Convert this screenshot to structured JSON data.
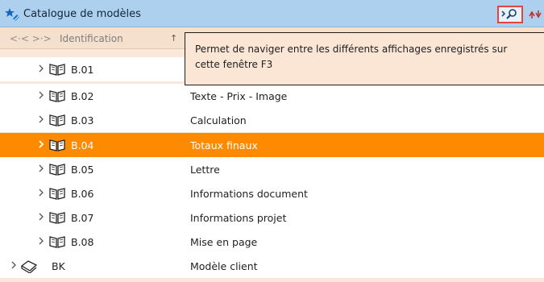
{
  "window": {
    "title": "Catalogue de modèles",
    "nav_button_icon": "view-navigator-icon",
    "refresh_button_icon": "refresh-icon"
  },
  "header": {
    "nav_arrows": "<·< >·>",
    "column_label": "Identification",
    "sort_indicator": "↑"
  },
  "tooltip": {
    "line1": "Permet de naviger entre les différents affichages enregistrés sur",
    "line2": "cette fenêtre  F3"
  },
  "rows": [
    {
      "code": "B.01",
      "label": "",
      "icon": "book-icon",
      "selected": false
    },
    {
      "code": "B.02",
      "label": "Texte - Prix - Image",
      "icon": "book-icon",
      "selected": false
    },
    {
      "code": "B.03",
      "label": "Calculation",
      "icon": "book-icon",
      "selected": false
    },
    {
      "code": "B.04",
      "label": "Totaux finaux",
      "icon": "book-icon",
      "selected": true
    },
    {
      "code": "B.05",
      "label": "Lettre",
      "icon": "book-icon",
      "selected": false
    },
    {
      "code": "B.06",
      "label": "Informations document",
      "icon": "book-icon",
      "selected": false
    },
    {
      "code": "B.07",
      "label": "Informations projet",
      "icon": "book-icon",
      "selected": false
    },
    {
      "code": "B.08",
      "label": "Mise en page",
      "icon": "book-icon",
      "selected": false
    },
    {
      "code": "BK",
      "label": "Modèle client",
      "icon": "catalog-icon",
      "selected": false
    }
  ],
  "colors": {
    "titlebar": "#aed0ef",
    "selection": "#fe8a02",
    "header": "#f5dfcd",
    "tooltip_bg": "#fbe6d6",
    "highlight_border": "#e0463d"
  }
}
